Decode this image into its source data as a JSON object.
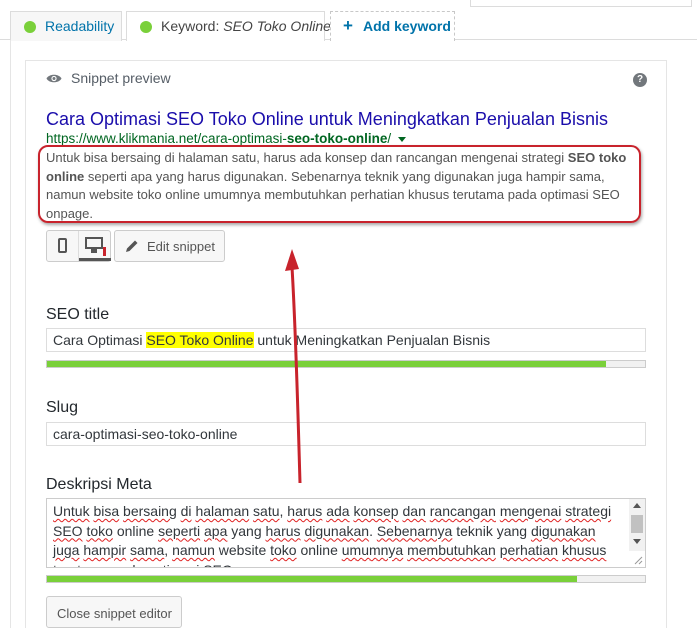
{
  "tabs": {
    "readability": "Readability",
    "keyword_prefix": "Keyword: ",
    "keyword_value": "SEO Toko Online",
    "add_keyword": "Add keyword",
    "add_icon": "+"
  },
  "preview": {
    "header": "Snippet preview",
    "help_icon": "?",
    "title": "Cara Optimasi SEO Toko Online untuk Meningkatkan Penjualan Bisnis",
    "url_prefix": "https://www.klikmania.net/cara-optimasi-",
    "url_bold": "seo-toko-online",
    "url_suffix": "/",
    "desc_part1": "Untuk bisa bersaing di halaman satu, harus ada konsep dan rancangan mengenai strategi ",
    "desc_bold": "SEO toko online",
    "desc_part2": " seperti apa yang harus digunakan. Sebenarnya teknik yang digunakan juga hampir sama, namun website toko online umumnya membutuhkan perhatian khusus terutama pada optimasi SEO onpage.",
    "edit_snippet": "Edit snippet"
  },
  "seo_title": {
    "label": "SEO title",
    "value_before": "Cara Optimasi ",
    "value_highlight": "SEO Toko Online",
    "value_after": " untuk Meningkatkan Penjualan Bisnis",
    "progress": 0.935
  },
  "slug": {
    "label": "Slug",
    "value": "cara-optimasi-seo-toko-online"
  },
  "meta_description": {
    "label": "Deskripsi Meta",
    "words": [
      "Untuk",
      " ",
      "bisa",
      " ",
      "bersaing",
      " ",
      "di",
      " ",
      "halaman",
      " ",
      "satu",
      ", ",
      "harus",
      " ",
      "ada",
      " ",
      "konsep",
      " ",
      "dan",
      " ",
      "rancangan",
      " ",
      "mengenai",
      " ",
      "strategi",
      " ",
      "SEO",
      " ",
      "toko",
      " online ",
      "seperti",
      " ",
      "apa",
      " yang ",
      "harus",
      " ",
      "digunakan",
      ". ",
      "Sebenarnya",
      " teknik yang ",
      "digunakan",
      " ",
      "juga",
      " ",
      "hampir",
      " ",
      "sama",
      ", ",
      "namun",
      " website ",
      "toko",
      " online ",
      "umumnya",
      " ",
      "membutuhkan",
      " ",
      "perhatian",
      " ",
      "khusus",
      " ",
      "terutama",
      " ",
      "pada",
      " ",
      "optimasi",
      " SEO ",
      "onpage",
      "."
    ],
    "progress": 0.887
  },
  "close_editor": "Close snippet editor",
  "colors": {
    "good": "#7ad03a",
    "link": "#1a0dab",
    "url": "#006621",
    "annotation": "#c8232c"
  }
}
